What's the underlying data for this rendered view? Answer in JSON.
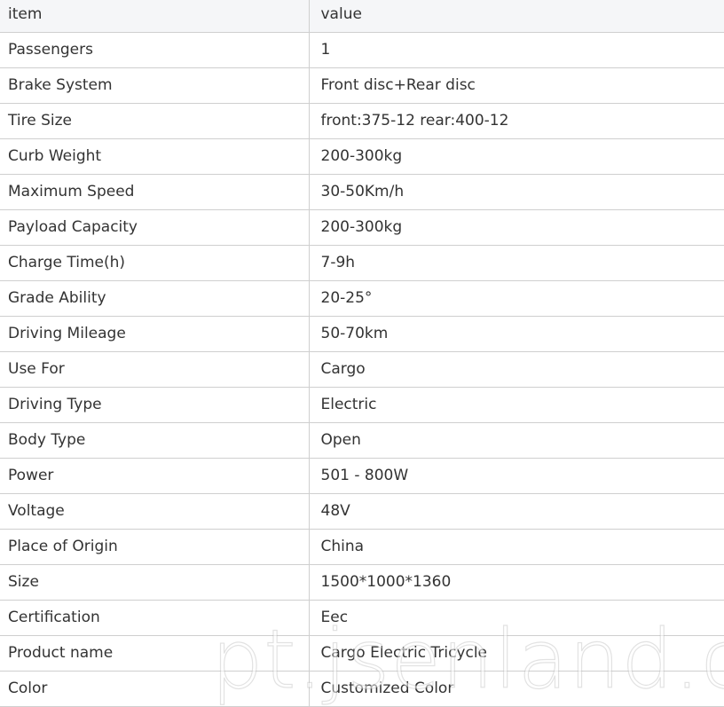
{
  "table": {
    "header": {
      "item": "item",
      "value": "value"
    },
    "rows": [
      {
        "item": "Passengers",
        "value": "1"
      },
      {
        "item": "Brake System",
        "value": "Front disc+Rear disc"
      },
      {
        "item": "Tire Size",
        "value": "front:375-12 rear:400-12"
      },
      {
        "item": "Curb Weight",
        "value": "200-300kg"
      },
      {
        "item": "Maximum Speed",
        "value": "30-50Km/h"
      },
      {
        "item": "Payload Capacity",
        "value": "200-300kg"
      },
      {
        "item": "Charge Time(h)",
        "value": "7-9h"
      },
      {
        "item": "Grade Ability",
        "value": "20-25°"
      },
      {
        "item": "Driving Mileage",
        "value": "50-70km"
      },
      {
        "item": "Use For",
        "value": "Cargo"
      },
      {
        "item": "Driving Type",
        "value": "Electric"
      },
      {
        "item": "Body Type",
        "value": "Open"
      },
      {
        "item": "Power",
        "value": "501 - 800W"
      },
      {
        "item": "Voltage",
        "value": "48V"
      },
      {
        "item": "Place of Origin",
        "value": "China"
      },
      {
        "item": "Size",
        "value": "1500*1000*1360"
      },
      {
        "item": "Certification",
        "value": "Eec"
      },
      {
        "item": "Product name",
        "value": "Cargo Electric Tricycle"
      },
      {
        "item": "Color",
        "value": "Customized Color"
      }
    ]
  },
  "watermark": "pt.jsenland.com",
  "colors": {
    "header_bg": "#f5f6f8",
    "border": "#cfcfcf",
    "text": "#333333"
  }
}
